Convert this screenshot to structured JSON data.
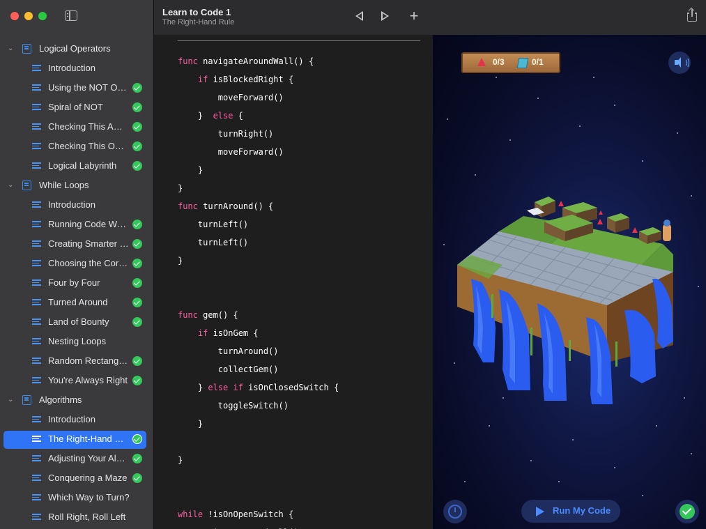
{
  "header": {
    "title": "Learn to Code 1",
    "subtitle": "The Right-Hand Rule"
  },
  "sidebar": {
    "items": [
      {
        "type": "chapter",
        "label": "Logical Operators"
      },
      {
        "type": "page",
        "label": "Introduction",
        "complete": false
      },
      {
        "type": "page",
        "label": "Using the NOT Operator",
        "complete": true
      },
      {
        "type": "page",
        "label": "Spiral of NOT",
        "complete": true
      },
      {
        "type": "page",
        "label": "Checking This AND That",
        "complete": true
      },
      {
        "type": "page",
        "label": "Checking This OR That",
        "complete": true
      },
      {
        "type": "page",
        "label": "Logical Labyrinth",
        "complete": true
      },
      {
        "type": "chapter",
        "label": "While Loops"
      },
      {
        "type": "page",
        "label": "Introduction",
        "complete": false
      },
      {
        "type": "page",
        "label": "Running Code While…",
        "complete": true
      },
      {
        "type": "page",
        "label": "Creating Smarter Loops",
        "complete": true
      },
      {
        "type": "page",
        "label": "Choosing the Correct Tool",
        "complete": true
      },
      {
        "type": "page",
        "label": "Four by Four",
        "complete": true
      },
      {
        "type": "page",
        "label": "Turned Around",
        "complete": true
      },
      {
        "type": "page",
        "label": "Land of Bounty",
        "complete": true
      },
      {
        "type": "page",
        "label": "Nesting Loops",
        "complete": false
      },
      {
        "type": "page",
        "label": "Random Rectangles",
        "complete": true
      },
      {
        "type": "page",
        "label": "You're Always Right",
        "complete": true
      },
      {
        "type": "chapter",
        "label": "Algorithms"
      },
      {
        "type": "page",
        "label": "Introduction",
        "complete": false
      },
      {
        "type": "page",
        "label": "The Right-Hand Rule",
        "complete": true,
        "selected": true
      },
      {
        "type": "page",
        "label": "Adjusting Your Algorithm",
        "complete": true
      },
      {
        "type": "page",
        "label": "Conquering a Maze",
        "complete": true
      },
      {
        "type": "page",
        "label": "Which Way to Turn?",
        "complete": false,
        "wide": true
      },
      {
        "type": "page",
        "label": "Roll Right, Roll Left",
        "complete": false,
        "wide": true
      }
    ]
  },
  "code": [
    {
      "line": [
        [
          "k",
          "func"
        ],
        [
          "t",
          " navigateAroundWall() {"
        ]
      ]
    },
    {
      "line": [
        [
          "t",
          "    "
        ],
        [
          "k",
          "if"
        ],
        [
          "t",
          " isBlockedRight {"
        ]
      ]
    },
    {
      "line": [
        [
          "t",
          "        moveForward()"
        ]
      ]
    },
    {
      "line": [
        [
          "t",
          "    }  "
        ],
        [
          "k",
          "else"
        ],
        [
          "t",
          " {"
        ]
      ]
    },
    {
      "line": [
        [
          "t",
          "        turnRight()"
        ]
      ]
    },
    {
      "line": [
        [
          "t",
          "        moveForward()"
        ]
      ]
    },
    {
      "line": [
        [
          "t",
          "    }"
        ]
      ]
    },
    {
      "line": [
        [
          "t",
          "}"
        ]
      ]
    },
    {
      "line": [
        [
          "k",
          "func"
        ],
        [
          "t",
          " turnAround() {"
        ]
      ]
    },
    {
      "line": [
        [
          "t",
          "    turnLeft()"
        ]
      ]
    },
    {
      "line": [
        [
          "t",
          "    turnLeft()"
        ]
      ]
    },
    {
      "line": [
        [
          "t",
          "}"
        ]
      ]
    },
    {
      "line": []
    },
    {
      "line": []
    },
    {
      "line": [
        [
          "k",
          "func"
        ],
        [
          "t",
          " gem() {"
        ]
      ]
    },
    {
      "line": [
        [
          "t",
          "    "
        ],
        [
          "k",
          "if"
        ],
        [
          "t",
          " isOnGem {"
        ]
      ]
    },
    {
      "line": [
        [
          "t",
          "        turnAround()"
        ]
      ]
    },
    {
      "line": [
        [
          "t",
          "        collectGem()"
        ]
      ]
    },
    {
      "line": [
        [
          "t",
          "    } "
        ],
        [
          "k",
          "else if"
        ],
        [
          "t",
          " isOnClosedSwitch {"
        ]
      ]
    },
    {
      "line": [
        [
          "t",
          "        toggleSwitch()"
        ]
      ]
    },
    {
      "line": [
        [
          "t",
          "    }"
        ]
      ]
    },
    {
      "line": []
    },
    {
      "line": [
        [
          "t",
          "}"
        ]
      ]
    },
    {
      "line": []
    },
    {
      "line": []
    },
    {
      "line": [
        [
          "k",
          "while"
        ],
        [
          "t",
          " !isOnOpenSwitch {"
        ]
      ]
    },
    {
      "line": [
        [
          "t",
          "    navigateAroundWall()"
        ]
      ]
    }
  ],
  "stage": {
    "gems_count": "0/3",
    "switches_count": "0/1",
    "run_label": "Run My Code"
  },
  "colors": {
    "accent": "#2f74f5",
    "keyword": "#fc5fa3",
    "success": "#34c759"
  }
}
